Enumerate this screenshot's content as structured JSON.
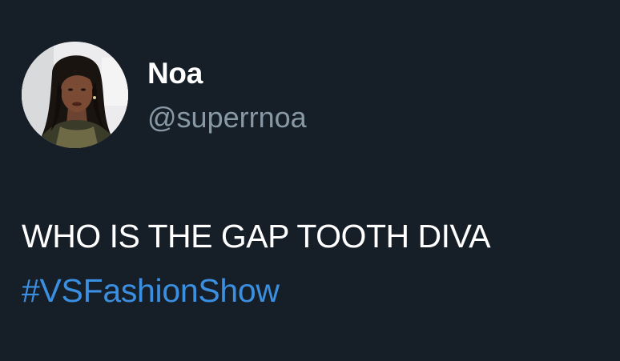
{
  "tweet": {
    "author": {
      "display_name": "Noa",
      "handle": "@superrnoa"
    },
    "text": "WHO IS THE GAP TOOTH DIVA",
    "hashtag": "#VSFashionShow"
  },
  "colors": {
    "background": "#161e28",
    "name_text": "#ffffff",
    "handle_text": "#8899a6",
    "body_text": "#ffffff",
    "hashtag_link": "#3b8fe0"
  }
}
